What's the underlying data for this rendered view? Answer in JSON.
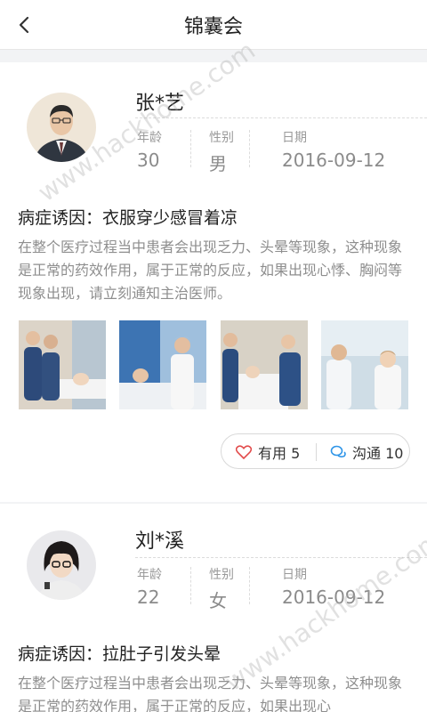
{
  "nav": {
    "title": "锦囊会"
  },
  "labels": {
    "age": "年龄",
    "gender": "性别",
    "date": "日期"
  },
  "posts": [
    {
      "name": "张*艺",
      "age": "30",
      "gender": "男",
      "date": "2016-09-12",
      "cause": "病症诱因：衣服穿少感冒着凉",
      "desc": "在整个医疗过程当中患者会出现乏力、头晕等现象，这种现象是正常的药效作用，属于正常的反应，如果出现心悸、胸闷等现象出现，请立刻通知主治医师。",
      "useful_label": "有用 5",
      "chat_label": "沟通 10"
    },
    {
      "name": "刘*溪",
      "age": "22",
      "gender": "女",
      "date": "2016-09-12",
      "cause": "病症诱因：拉肚子引发头晕",
      "desc": "在整个医疗过程当中患者会出现乏力、头晕等现象，这种现象是正常的药效作用，属于正常的反应，如果出现心"
    }
  ],
  "watermark": "www.hackhome.com",
  "colors": {
    "accent_heart": "#e24b4b",
    "accent_chat": "#2f95e8",
    "muted": "#8e8e8e"
  }
}
